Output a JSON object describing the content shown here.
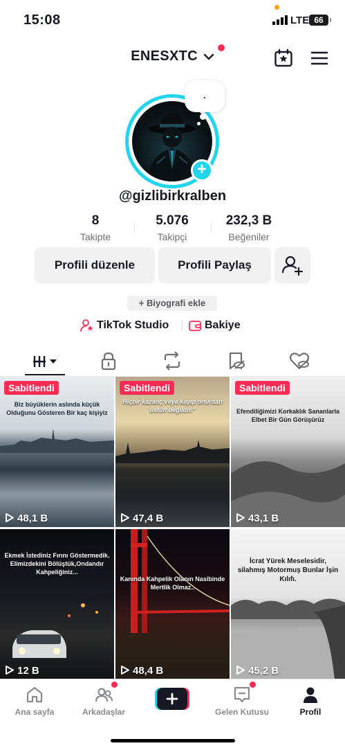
{
  "status_bar": {
    "time": "15:08",
    "network": "LTE",
    "battery": "66"
  },
  "header": {
    "account_name": "ENESXTC"
  },
  "profile": {
    "note": ".",
    "username": "@gizlibirkralben",
    "stats": [
      {
        "value": "8",
        "label": "Takipte"
      },
      {
        "value": "5.076",
        "label": "Takipçi"
      },
      {
        "value": "232,3 B",
        "label": "Beğeniler"
      }
    ],
    "edit_label": "Profili düzenle",
    "share_label": "Profili Paylaş",
    "bio_add_label": "+ Biyografi ekle",
    "studio_label": "TikTok Studio",
    "balance_label": "Bakiye"
  },
  "videos": [
    {
      "pinned": "Sabitlendi",
      "caption": "Biz büyüklerin aslında küçük Olduğunu Gösteren Bir kaç kişiyiz",
      "views": "48,1 B"
    },
    {
      "pinned": "Sabitlendi",
      "caption": "Hiçbir kazanç veya kayıp onurdan üstün değildir.\"",
      "views": "47,4 B"
    },
    {
      "pinned": "Sabitlendi",
      "caption": "Efendiliğimizi Korkaklık Sananlarla Elbet Bir Gün Görüşürüz",
      "views": "43,1 B"
    },
    {
      "pinned": "",
      "caption": "Ekmek İstediniz Fırını Göstermedik. Elimizdekini Bölüştük,Ondandır Kahpeliğiniz...",
      "views": "12 B"
    },
    {
      "pinned": "",
      "caption": "Kanında Kahpelik Olanın Nasibinde Mertlik Olmaz..",
      "views": "48,4 B"
    },
    {
      "pinned": "",
      "caption": "İcrat Yürek Meselesidir, silahmış Motormuş Bunlar İşin Kılıfı.",
      "views": "45,2 B"
    }
  ],
  "bottom_nav": {
    "home": "Ana sayfa",
    "friends": "Arkadaşlar",
    "inbox": "Gelen Kutusu",
    "profile": "Profil"
  },
  "colors": {
    "accent": "#fe2c55",
    "cyan": "#20d5ec",
    "text": "#161823"
  }
}
